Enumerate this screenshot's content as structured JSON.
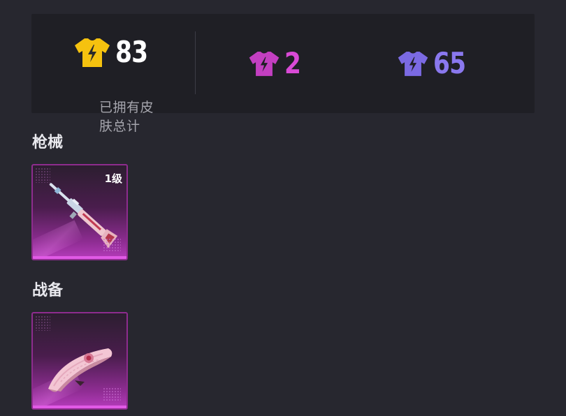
{
  "stats": {
    "total": {
      "value": "83",
      "label": "已拥有皮肤总计",
      "icon": "yellow-tshirt-icon",
      "color": "#f5c20f"
    },
    "pink": {
      "value": "2",
      "icon": "pink-tshirt-icon",
      "color": "#d94ad6"
    },
    "purple": {
      "value": "65",
      "icon": "purple-tshirt-icon",
      "color": "#8a78ee"
    }
  },
  "sections": [
    {
      "title": "枪械",
      "items": [
        {
          "level": "1级",
          "icon": "rifle-skin-icon"
        }
      ]
    },
    {
      "title": "战备",
      "items": [
        {
          "icon": "glider-skin-icon"
        }
      ]
    }
  ]
}
